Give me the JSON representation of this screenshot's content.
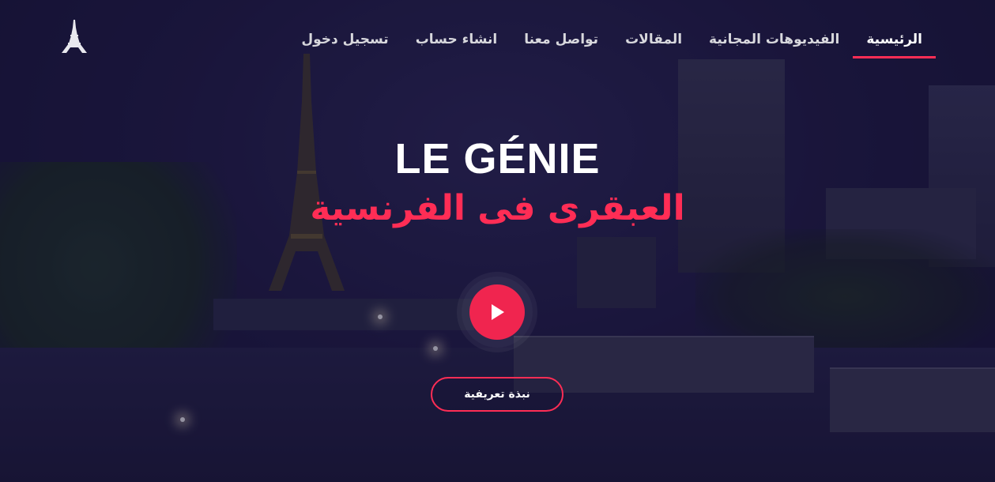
{
  "nav": {
    "items": [
      {
        "label": "الرئيسية",
        "active": true
      },
      {
        "label": "الفيديوهات المجانية",
        "active": false
      },
      {
        "label": "المقالات",
        "active": false
      },
      {
        "label": "تواصل معنا",
        "active": false
      },
      {
        "label": "انشاء حساب",
        "active": false
      },
      {
        "label": "تسجيل دخول",
        "active": false
      }
    ]
  },
  "logo": {
    "icon": "eiffel-tower-icon"
  },
  "hero": {
    "title": "LE GÉNIE",
    "subtitle": "العبقرى فى الفرنسية",
    "play_icon": "play-icon",
    "intro_button": "نبذة تعريفية"
  },
  "colors": {
    "accent": "#ff2d55",
    "text": "#ffffff",
    "nav_text": "#d8d8dd",
    "background": "#1e1a3d"
  }
}
